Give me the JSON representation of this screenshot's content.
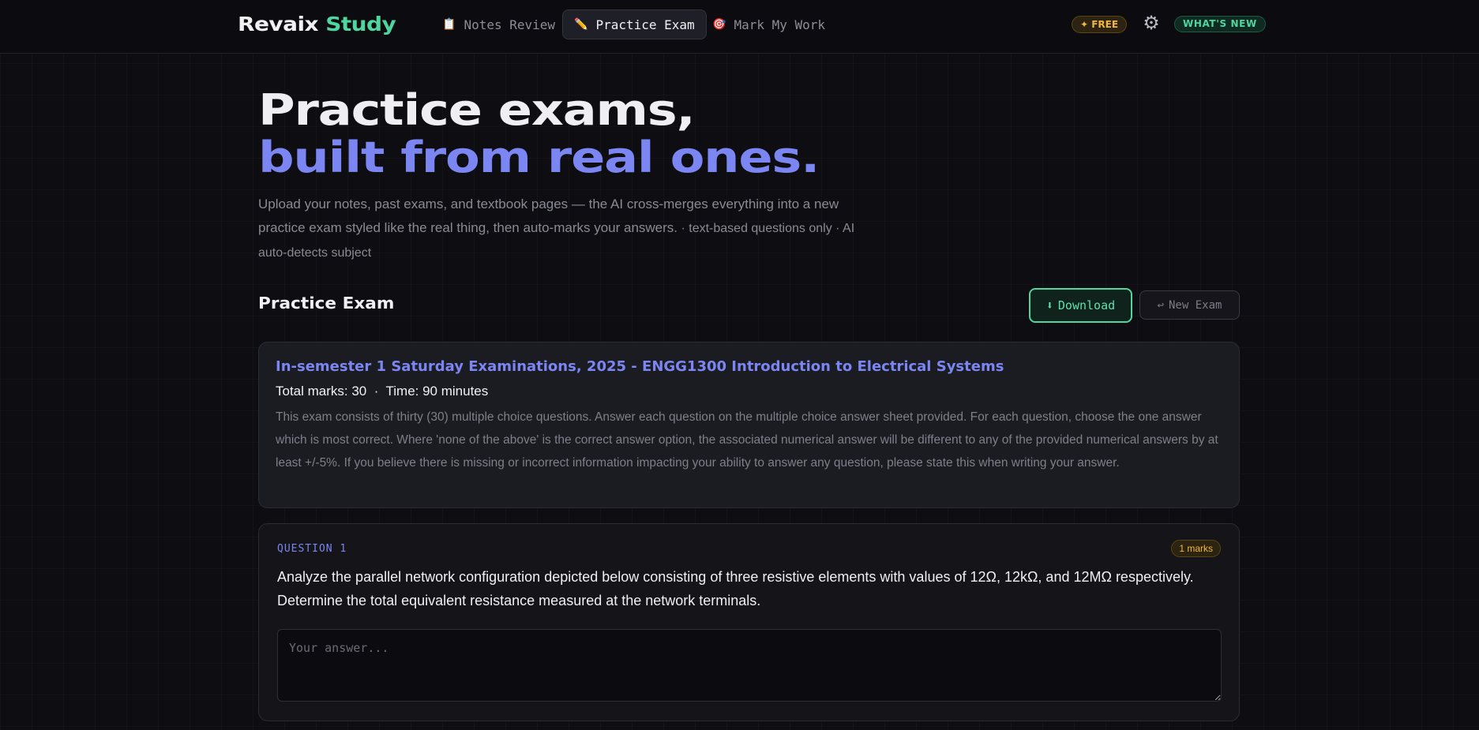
{
  "nav": {
    "logo_part1": "Revaix",
    "logo_part2": "Study",
    "tabs": [
      {
        "icon": "📋",
        "icon_name": "clipboard-icon",
        "label": "Notes Review"
      },
      {
        "icon": "✏️",
        "icon_name": "pencil-icon",
        "label": "Practice Exam",
        "active": true
      },
      {
        "icon": "🎯",
        "icon_name": "target-icon",
        "label": "Mark My Work"
      }
    ],
    "free_badge": "✦ FREE",
    "settings_icon": "⚙",
    "whats_new": "WHAT'S NEW"
  },
  "hero": {
    "title_line1": "Practice exams,",
    "title_line2": "built from real ones.",
    "subtitle": "Upload your notes, past exams, and textbook pages — the AI cross-merges everything into a new practice exam styled like the real thing, then auto-marks your answers.",
    "subtitle_small": " · text-based questions only · AI auto-detects subject"
  },
  "section": {
    "title": "Practice Exam",
    "download_icon": "⬇",
    "download_label": "Download",
    "new_exam_icon": "↩",
    "new_exam_label": "New Exam"
  },
  "exam": {
    "title": "In-semester 1 Saturday Examinations, 2025 - ENGG1300 Introduction to Electrical Systems",
    "meta": "Total marks: 30  ·  Time: 90 minutes",
    "instructions": "This exam consists of thirty (30) multiple choice questions. Answer each question on the multiple choice answer sheet provided. For each question, choose the one answer which is most correct. Where 'none of the above' is the correct answer option, the associated numerical answer will be different to any of the provided numerical answers by at least +/-5%. If you believe there is missing or incorrect information impacting your ability to answer any question, please state this when writing your answer."
  },
  "question": {
    "label": "QUESTION 1",
    "marks": "1 marks",
    "text": "Analyze the parallel network configuration depicted below consisting of three resistive elements with values of 12Ω, 12kΩ, and 12MΩ respectively. Determine the total equivalent resistance measured at the network terminals.",
    "answer_placeholder": "Your answer...",
    "answer_value": ""
  },
  "colors": {
    "accent_indigo": "#7b86f2",
    "accent_green": "#4fd6a0",
    "accent_amber": "#f3b63a",
    "background": "#0e0e12"
  }
}
